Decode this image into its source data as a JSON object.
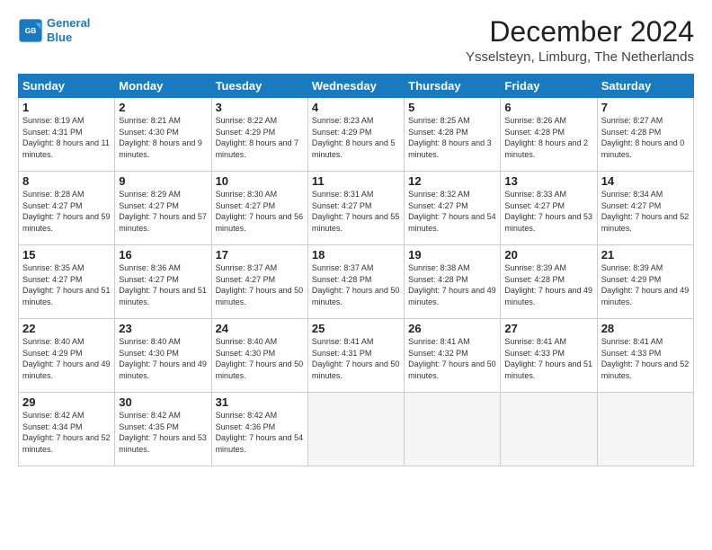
{
  "logo": {
    "line1": "General",
    "line2": "Blue"
  },
  "title": "December 2024",
  "location": "Ysselsteyn, Limburg, The Netherlands",
  "days_of_week": [
    "Sunday",
    "Monday",
    "Tuesday",
    "Wednesday",
    "Thursday",
    "Friday",
    "Saturday"
  ],
  "weeks": [
    [
      {
        "day": "1",
        "sunrise": "8:19 AM",
        "sunset": "4:31 PM",
        "daylight": "8 hours and 11 minutes."
      },
      {
        "day": "2",
        "sunrise": "8:21 AM",
        "sunset": "4:30 PM",
        "daylight": "8 hours and 9 minutes."
      },
      {
        "day": "3",
        "sunrise": "8:22 AM",
        "sunset": "4:29 PM",
        "daylight": "8 hours and 7 minutes."
      },
      {
        "day": "4",
        "sunrise": "8:23 AM",
        "sunset": "4:29 PM",
        "daylight": "8 hours and 5 minutes."
      },
      {
        "day": "5",
        "sunrise": "8:25 AM",
        "sunset": "4:28 PM",
        "daylight": "8 hours and 3 minutes."
      },
      {
        "day": "6",
        "sunrise": "8:26 AM",
        "sunset": "4:28 PM",
        "daylight": "8 hours and 2 minutes."
      },
      {
        "day": "7",
        "sunrise": "8:27 AM",
        "sunset": "4:28 PM",
        "daylight": "8 hours and 0 minutes."
      }
    ],
    [
      {
        "day": "8",
        "sunrise": "8:28 AM",
        "sunset": "4:27 PM",
        "daylight": "7 hours and 59 minutes."
      },
      {
        "day": "9",
        "sunrise": "8:29 AM",
        "sunset": "4:27 PM",
        "daylight": "7 hours and 57 minutes."
      },
      {
        "day": "10",
        "sunrise": "8:30 AM",
        "sunset": "4:27 PM",
        "daylight": "7 hours and 56 minutes."
      },
      {
        "day": "11",
        "sunrise": "8:31 AM",
        "sunset": "4:27 PM",
        "daylight": "7 hours and 55 minutes."
      },
      {
        "day": "12",
        "sunrise": "8:32 AM",
        "sunset": "4:27 PM",
        "daylight": "7 hours and 54 minutes."
      },
      {
        "day": "13",
        "sunrise": "8:33 AM",
        "sunset": "4:27 PM",
        "daylight": "7 hours and 53 minutes."
      },
      {
        "day": "14",
        "sunrise": "8:34 AM",
        "sunset": "4:27 PM",
        "daylight": "7 hours and 52 minutes."
      }
    ],
    [
      {
        "day": "15",
        "sunrise": "8:35 AM",
        "sunset": "4:27 PM",
        "daylight": "7 hours and 51 minutes."
      },
      {
        "day": "16",
        "sunrise": "8:36 AM",
        "sunset": "4:27 PM",
        "daylight": "7 hours and 51 minutes."
      },
      {
        "day": "17",
        "sunrise": "8:37 AM",
        "sunset": "4:27 PM",
        "daylight": "7 hours and 50 minutes."
      },
      {
        "day": "18",
        "sunrise": "8:37 AM",
        "sunset": "4:28 PM",
        "daylight": "7 hours and 50 minutes."
      },
      {
        "day": "19",
        "sunrise": "8:38 AM",
        "sunset": "4:28 PM",
        "daylight": "7 hours and 49 minutes."
      },
      {
        "day": "20",
        "sunrise": "8:39 AM",
        "sunset": "4:28 PM",
        "daylight": "7 hours and 49 minutes."
      },
      {
        "day": "21",
        "sunrise": "8:39 AM",
        "sunset": "4:29 PM",
        "daylight": "7 hours and 49 minutes."
      }
    ],
    [
      {
        "day": "22",
        "sunrise": "8:40 AM",
        "sunset": "4:29 PM",
        "daylight": "7 hours and 49 minutes."
      },
      {
        "day": "23",
        "sunrise": "8:40 AM",
        "sunset": "4:30 PM",
        "daylight": "7 hours and 49 minutes."
      },
      {
        "day": "24",
        "sunrise": "8:40 AM",
        "sunset": "4:30 PM",
        "daylight": "7 hours and 50 minutes."
      },
      {
        "day": "25",
        "sunrise": "8:41 AM",
        "sunset": "4:31 PM",
        "daylight": "7 hours and 50 minutes."
      },
      {
        "day": "26",
        "sunrise": "8:41 AM",
        "sunset": "4:32 PM",
        "daylight": "7 hours and 50 minutes."
      },
      {
        "day": "27",
        "sunrise": "8:41 AM",
        "sunset": "4:33 PM",
        "daylight": "7 hours and 51 minutes."
      },
      {
        "day": "28",
        "sunrise": "8:41 AM",
        "sunset": "4:33 PM",
        "daylight": "7 hours and 52 minutes."
      }
    ],
    [
      {
        "day": "29",
        "sunrise": "8:42 AM",
        "sunset": "4:34 PM",
        "daylight": "7 hours and 52 minutes."
      },
      {
        "day": "30",
        "sunrise": "8:42 AM",
        "sunset": "4:35 PM",
        "daylight": "7 hours and 53 minutes."
      },
      {
        "day": "31",
        "sunrise": "8:42 AM",
        "sunset": "4:36 PM",
        "daylight": "7 hours and 54 minutes."
      },
      null,
      null,
      null,
      null
    ]
  ],
  "labels": {
    "sunrise_prefix": "Sunrise: ",
    "sunset_prefix": "Sunset: ",
    "daylight_prefix": "Daylight: "
  }
}
